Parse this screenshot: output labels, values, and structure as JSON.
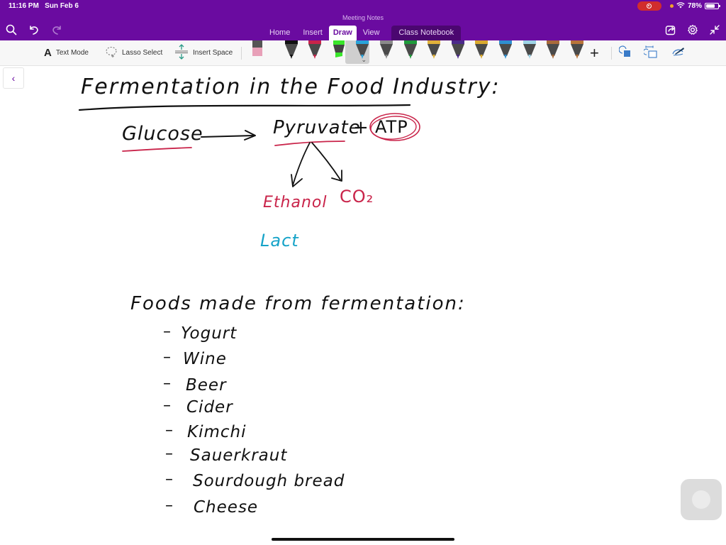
{
  "status_bar": {
    "time": "11:16 PM",
    "date": "Sun Feb 6",
    "battery": "78%",
    "battery_level": 0.78
  },
  "app": {
    "doc_title": "Meeting Notes",
    "tabs": [
      {
        "label": "Home"
      },
      {
        "label": "Insert"
      },
      {
        "label": "Draw",
        "active": true
      },
      {
        "label": "View"
      },
      {
        "label": "Class Notebook"
      }
    ],
    "left_icons": [
      "search-icon",
      "undo-icon",
      "redo-icon"
    ],
    "right_icons": [
      "share-icon",
      "settings-icon",
      "collapse-icon"
    ]
  },
  "toolbar": {
    "text_mode": "Text Mode",
    "lasso_select": "Lasso Select",
    "insert_space": "Insert Space",
    "pens": [
      {
        "name": "eraser",
        "color": "#e8a0b8"
      },
      {
        "name": "pen-black",
        "color": "#111111"
      },
      {
        "name": "pen-red",
        "color": "#c9244a"
      },
      {
        "name": "highlighter-green",
        "color": "#39e62a"
      },
      {
        "name": "pen-cyan",
        "color": "#29a3d9",
        "selected": true
      },
      {
        "name": "pen-gray",
        "color": "#8a8a8a"
      },
      {
        "name": "pen-green",
        "color": "#1f9a3b"
      },
      {
        "name": "pen-yellow",
        "color": "#e0b13a"
      },
      {
        "name": "pen-purple",
        "color": "#4b2a8a"
      },
      {
        "name": "pen-gold",
        "color": "#d9a92e"
      },
      {
        "name": "pen-blue",
        "color": "#2f8fd0"
      },
      {
        "name": "pen-lightblue",
        "color": "#9dd3e6"
      },
      {
        "name": "pen-brown",
        "color": "#a86a3a"
      },
      {
        "name": "pen-copper",
        "color": "#b8743a"
      }
    ]
  },
  "note": {
    "title": "Fermentation in the Food Industry:",
    "equation": {
      "reactant": "Glucose",
      "arrow": "——→",
      "product": "Pyruvate",
      "plus": "+",
      "energy": "ATP"
    },
    "branches": [
      "Ethanol",
      "CO₂"
    ],
    "partial_word": "Lact",
    "list_heading": "Foods made from fermentation:",
    "foods": [
      "Yogurt",
      "Wine",
      "Beer",
      "Cider",
      "Kimchi",
      "Sauerkraut",
      "Sourdough bread",
      "Cheese"
    ],
    "bullet": "–"
  }
}
